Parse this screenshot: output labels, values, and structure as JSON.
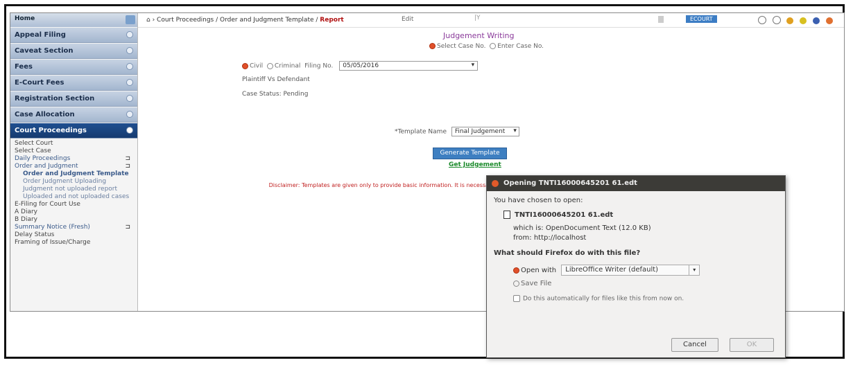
{
  "sidebar": {
    "top_label": "Home",
    "sections": [
      {
        "label": "Appeal Filing"
      },
      {
        "label": "Caveat Section"
      },
      {
        "label": "Fees"
      },
      {
        "label": "E-Court Fees"
      },
      {
        "label": "Registration Section"
      },
      {
        "label": "Case Allocation"
      },
      {
        "label": "Court Proceedings"
      }
    ],
    "items": [
      "Select Court",
      "Select Case",
      "Daily Proceedings",
      "Order and Judgment",
      "Order and Judgment Template",
      "Order Judgment Uploading",
      "Judgment not uploaded report",
      "Uploaded and not uploaded cases",
      "E-Filing for Court Use",
      "A Diary",
      "B Diary",
      "Summary Notice (Fresh)",
      "Delay Status",
      "Framing of Issue/Charge"
    ]
  },
  "topbar": {
    "breadcrumb_root": "Court Proceedings",
    "breadcrumb_mid": "Order and Judgment Template",
    "breadcrumb_current": "Report",
    "edit_label": "Edit",
    "user_label": "ECOURT"
  },
  "main": {
    "title": "Judgement Writing",
    "case_mode_options": [
      "Select Case No.",
      "Enter Case No."
    ],
    "court_options": [
      "Civil",
      "Criminal",
      "Filing No."
    ],
    "date_value": "05/05/2016",
    "parties": "Plaintiff Vs Defendant",
    "case_status": "Case Status: Pending",
    "template_label": "*Template Name",
    "template_value": "Final Judgement",
    "generate_button": "Generate Template",
    "download_link": "Get Judgement",
    "disclaimer": "Disclaimer: Templates are given only to provide basic information. It is necessary to verify the contents and make suitable modifications before generating the order."
  },
  "dialog": {
    "title": "Opening TNTI16000645201 61.edt",
    "chosen_text": "You have chosen to open:",
    "filename": "TNTI16000645201 61.edt",
    "which_is": "which is: OpenDocument Text (12.0 KB)",
    "from": "from: http://localhost",
    "question": "What should Firefox do with this file?",
    "open_with_label": "Open with",
    "app_value": "LibreOffice Writer (default)",
    "save_label": "Save File",
    "auto_label": "Do this automatically for files like this from now on.",
    "cancel_label": "Cancel",
    "ok_label": "OK"
  }
}
